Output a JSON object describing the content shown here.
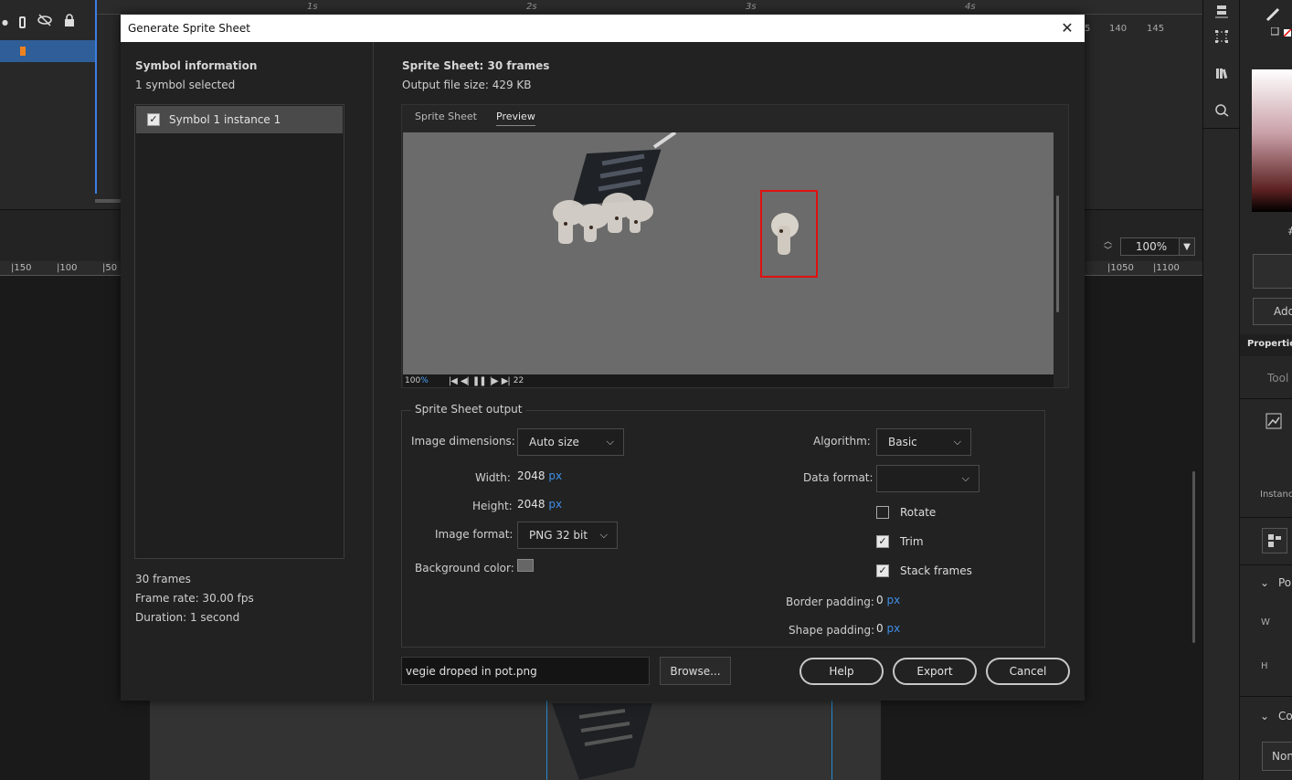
{
  "dialog": {
    "title": "Generate Sprite Sheet",
    "close_glyph": "✕"
  },
  "left": {
    "section_title": "Symbol information",
    "selected_count": "1 symbol selected",
    "symbols": [
      {
        "label": "Symbol 1 instance 1",
        "checked": true
      }
    ],
    "frames": "30 frames",
    "frame_rate": "Frame rate: 30.00 fps",
    "duration": "Duration: 1 second"
  },
  "sheet": {
    "title": "Sprite Sheet: 30 frames",
    "file_size": "Output file size: 429 KB",
    "tabs": [
      "Sprite Sheet",
      "Preview"
    ],
    "active_tab": "Preview"
  },
  "playbar": {
    "zoom": "100",
    "zoom_unit": "%",
    "frame": "22"
  },
  "output": {
    "legend": "Sprite Sheet output",
    "image_dimensions_label": "Image dimensions:",
    "image_dimensions_value": "Auto size",
    "width_label": "Width:",
    "width_value": "2048",
    "height_label": "Height:",
    "height_value": "2048",
    "px": "px",
    "image_format_label": "Image format:",
    "image_format_value": "PNG 32 bit",
    "background_label": "Background color:",
    "background_color": "#666666",
    "algorithm_label": "Algorithm:",
    "algorithm_value": "Basic",
    "data_format_label": "Data format:",
    "data_format_value": "",
    "rotate_label": "Rotate",
    "rotate_checked": false,
    "trim_label": "Trim",
    "trim_checked": true,
    "stack_label": "Stack frames",
    "stack_checked": true,
    "border_padding_label": "Border padding:",
    "border_padding_value": "0",
    "shape_padding_label": "Shape padding:",
    "shape_padding_value": "0"
  },
  "footer": {
    "filename": "vegie droped in pot.png",
    "browse": "Browse...",
    "help": "Help",
    "export": "Export",
    "cancel": "Cancel"
  },
  "background_app": {
    "ruler_ticks": [
      "1s",
      "2s",
      "3s",
      "4s"
    ],
    "ruler_frames": [
      "5",
      "140",
      "145"
    ],
    "stage_ruler_left": [
      "|150",
      "|100",
      "|50"
    ],
    "stage_ruler_right": [
      "|1050",
      "|1100"
    ],
    "zoom": "100%",
    "right_panel": {
      "add": "Add",
      "properties": "Properties",
      "tool": "Tool",
      "instance": "Instanc",
      "position": "Po",
      "w": "W",
      "h": "H",
      "color": "Co",
      "none": "Non",
      "hash": "#"
    }
  },
  "colors": {
    "accent_blue": "#3f8fe8",
    "selection_red": "#e01010",
    "layer_blue": "#2f5e98",
    "keyframe_orange": "#f0821e"
  }
}
